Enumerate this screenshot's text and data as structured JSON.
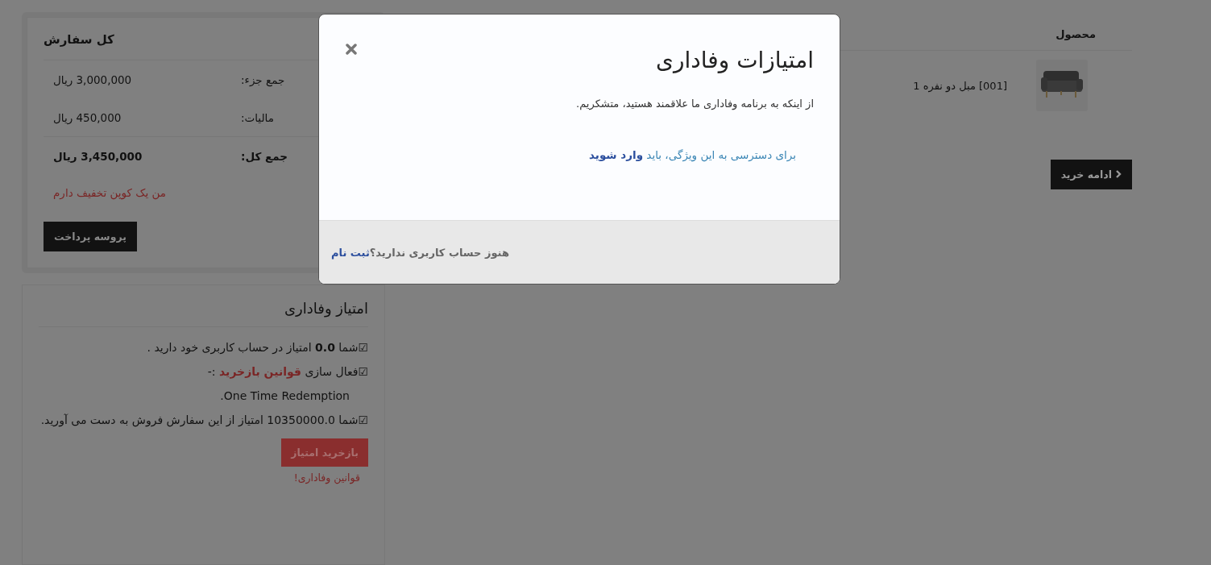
{
  "product_table": {
    "columns": [
      "محصول"
    ],
    "rows": [
      {
        "name": "[001] مبل دو نفره 1"
      }
    ]
  },
  "continue_button": {
    "label": "ادامه خرید"
  },
  "order_summary": {
    "title": "کل سفارش",
    "rows": [
      {
        "label": "جمع جزء:",
        "value": "3,000,000 ریال",
        "bold": false
      },
      {
        "label": "مالیات:",
        "value": "450,000 ریال",
        "bold": false
      },
      {
        "label": "جمع کل:",
        "value": "3,450,000 ریال",
        "bold": true
      }
    ],
    "coupon_link": "من یک کوپن تخفیف دارم",
    "checkout_button": "پروسه پرداخت"
  },
  "loyalty": {
    "title": "امتیاز وفاداری",
    "lines": [
      {
        "kind": "text",
        "text": "☑شما **0.0** امتیاز در حساب کاربری خود دارید ."
      },
      {
        "kind": "link",
        "text": "☑فعال سازی ",
        "link": "قوانین بازخرید",
        "after": " :-"
      },
      {
        "kind": "text",
        "text": "One Time Redemption."
      },
      {
        "kind": "text",
        "text": "☑شما 10350000.0 امتیاز از این سفارش فروش به دست می آورید."
      }
    ],
    "redeem_button": "بازخرید امتیاز",
    "rules_link": "قوانین وفاداری!"
  },
  "modal": {
    "title": "امتیازات وفاداری",
    "message": "از اینکه به برنامه وفاداری ما علاقمند هستید، متشکریم.",
    "login_prompt": "برای دسترسی به این ویژگی، باید",
    "login_link": "وارد شوید",
    "footer_text": "هنوز حساب کاربری ندارید؟",
    "signup_link": "ثبت نام"
  }
}
